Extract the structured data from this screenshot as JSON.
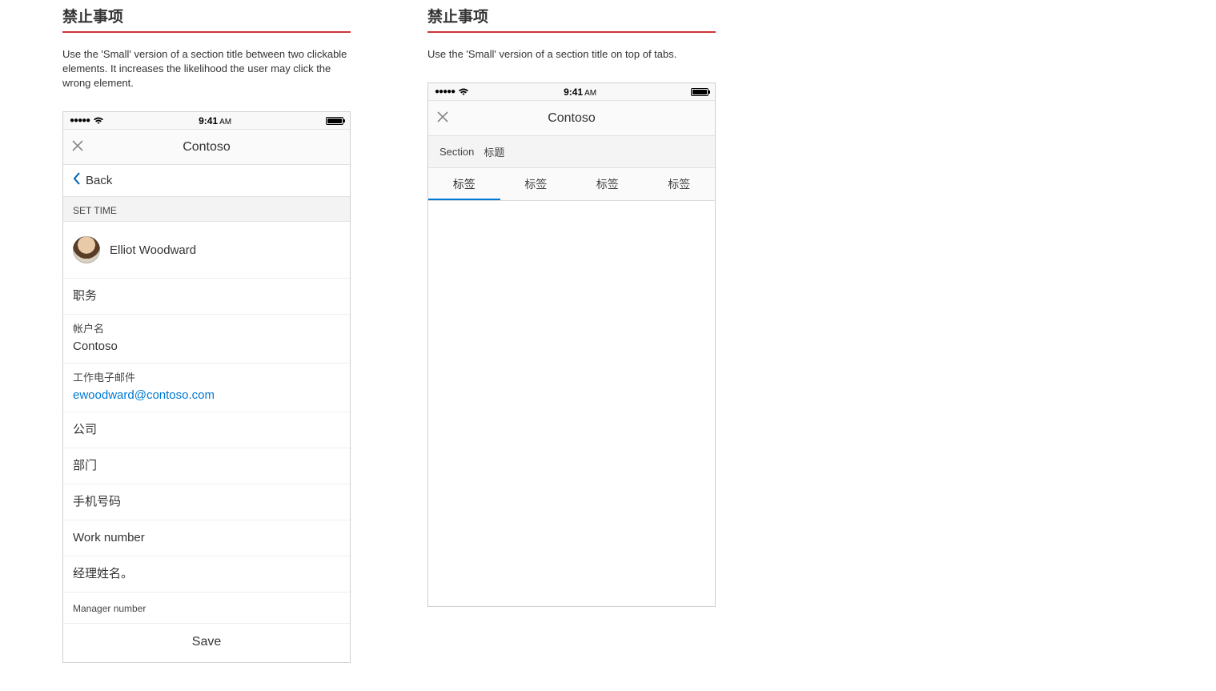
{
  "left": {
    "heading": "禁止事项",
    "description": "Use the 'Small' version of a section title between two clickable elements.      It increases the likelihood the user may click the wrong element.",
    "phone": {
      "status": {
        "signal": "●●●●●",
        "wifi": "wifi-icon",
        "time": "9:41",
        "ampm": "AM"
      },
      "nav": {
        "title": "Contoso"
      },
      "back": "Back",
      "section_caption": "SET TIME",
      "profile_name": "Elliot Woodward",
      "rows": {
        "job_title_label": "职务",
        "account_label": "帐户名",
        "account_value": "Contoso",
        "work_email_label": "工作电子邮件",
        "work_email_value": "ewoodward@contoso.com",
        "company_label": "公司",
        "department_label": "部门",
        "mobile_label": "手机号码",
        "work_number_label": "Work number",
        "manager_name_label": "经理姓名。",
        "manager_number_label": "Manager number"
      },
      "save": "Save"
    }
  },
  "right": {
    "heading": "禁止事项",
    "description": "Use the 'Small' version of a section title on top of tabs.",
    "phone": {
      "status": {
        "signal": "●●●●●",
        "wifi": "wifi-icon",
        "time": "9:41",
        "ampm": "AM"
      },
      "nav": {
        "title": "Contoso"
      },
      "section_label": "Section",
      "section_value": "标题",
      "tabs": [
        "标签",
        "标签",
        "标签",
        "标签"
      ]
    }
  }
}
